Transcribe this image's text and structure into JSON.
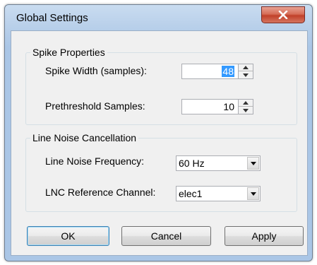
{
  "window": {
    "title": "Global Settings",
    "close_icon": "close-icon"
  },
  "spike_properties": {
    "legend": "Spike Properties",
    "spike_width": {
      "label": "Spike Width (samples):",
      "value": "48"
    },
    "prethreshold": {
      "label": "Prethreshold Samples:",
      "value": "10"
    }
  },
  "line_noise": {
    "legend": "Line Noise Cancellation",
    "frequency": {
      "label": "Line Noise Frequency:",
      "value": "60 Hz"
    },
    "reference": {
      "label": "LNC Reference Channel:",
      "value": "elec1"
    }
  },
  "buttons": {
    "ok": "OK",
    "cancel": "Cancel",
    "apply": "Apply"
  },
  "colors": {
    "frame": "#b9d0ea",
    "close_button": "#c8452e",
    "selection": "#3399ff"
  }
}
